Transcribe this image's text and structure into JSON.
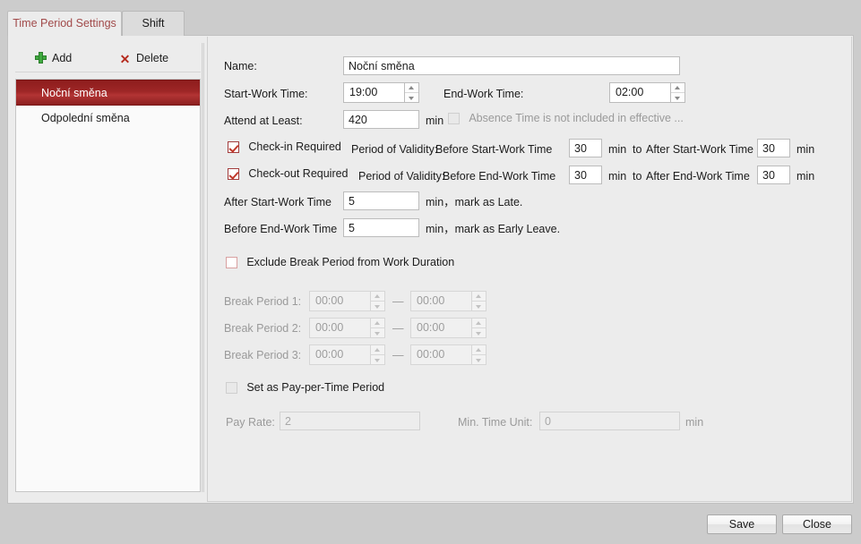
{
  "tabs": [
    {
      "label": "Time Period Settings",
      "active": true
    },
    {
      "label": "Shift",
      "active": false
    }
  ],
  "toolbar": {
    "add_label": "Add",
    "delete_label": "Delete",
    "add_icon": "plus-icon",
    "delete_icon": "x-icon"
  },
  "time_period_list": [
    {
      "label": "Noční směna",
      "selected": true
    },
    {
      "label": "Odpolední směna",
      "selected": false
    }
  ],
  "form": {
    "name_label": "Name:",
    "name_value": "Noční směna",
    "start_work_label": "Start-Work Time:",
    "start_work_value": "19:00",
    "end_work_label": "End-Work Time:",
    "end_work_value": "02:00",
    "attend_at_least_label": "Attend at Least:",
    "attend_at_least_value": "420",
    "attend_unit": "min",
    "absence_note": "Absence Time is not included in effective ...",
    "absence_checked": false,
    "checkin": {
      "label": "Check-in Required",
      "checked": true,
      "validity_label": "Period of Validity:",
      "before_label": "Before Start-Work Time",
      "before_value": "30",
      "before_unit": "min",
      "to_label": "to",
      "after_label": "After Start-Work Time",
      "after_value": "30",
      "after_unit": "min"
    },
    "checkout": {
      "label": "Check-out Required",
      "checked": true,
      "validity_label": "Period of Validity:",
      "before_label": "Before End-Work Time",
      "before_value": "30",
      "before_unit": "min",
      "to_label": "to",
      "after_label": "After End-Work Time",
      "after_value": "30",
      "after_unit": "min"
    },
    "late_label": "After Start-Work Time",
    "late_value": "5",
    "late_suffix": "min，mark as Late.",
    "early_label": "Before End-Work Time",
    "early_value": "5",
    "early_suffix": "min，mark as Early Leave.",
    "exclude_break_label": "Exclude Break Period from Work Duration",
    "exclude_break_checked": false,
    "break_periods": [
      {
        "label": "Break Period 1:",
        "start": "00:00",
        "end": "00:00",
        "sep": "—"
      },
      {
        "label": "Break Period 2:",
        "start": "00:00",
        "end": "00:00",
        "sep": "—"
      },
      {
        "label": "Break Period 3:",
        "start": "00:00",
        "end": "00:00",
        "sep": "—"
      }
    ],
    "pay_per_time_label": "Set as Pay-per-Time Period",
    "pay_per_time_checked": false,
    "pay_rate_label": "Pay Rate:",
    "pay_rate_value": "2",
    "min_time_unit_label": "Min. Time Unit:",
    "min_time_unit_value": "0",
    "min_time_unit_suffix": "min"
  },
  "footer": {
    "save_label": "Save",
    "close_label": "Close"
  },
  "colors": {
    "accent_red": "#9e2626",
    "tab_active_text": "#a14a4a",
    "check_red": "#c0392b",
    "add_green": "#3faa3f",
    "window_bg": "#ececec",
    "outer_bg": "#cccccc"
  }
}
